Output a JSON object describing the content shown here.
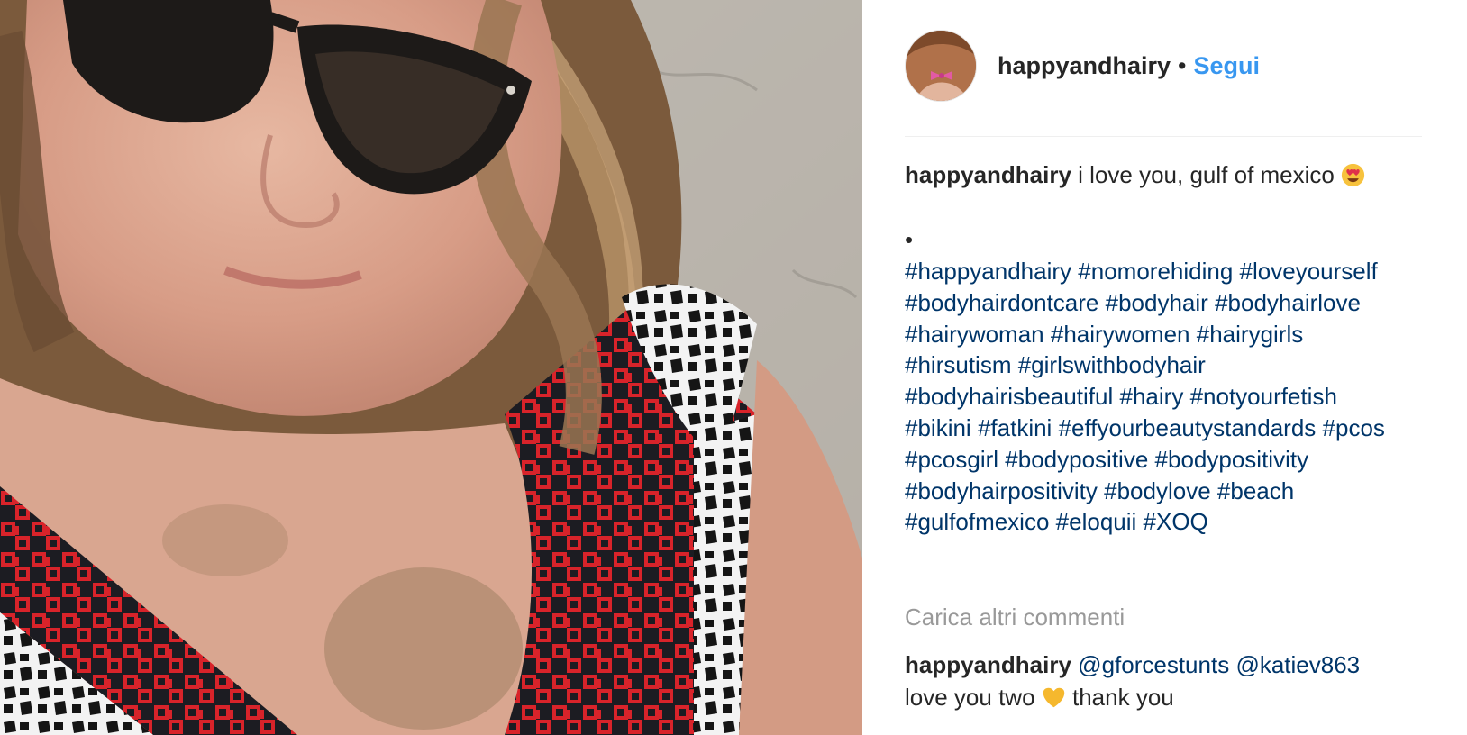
{
  "post": {
    "username": "happyandhairy",
    "separator": "•",
    "follow_label": "Segui"
  },
  "caption": {
    "username": "happyandhairy",
    "text": "i love you, gulf of mexico",
    "emoji": "heart-eyes-emoji",
    "bullet": "•",
    "hashtags": [
      "#happyandhairy",
      "#nomorehiding",
      "#loveyourself",
      "#bodyhairdontcare",
      "#bodyhair",
      "#bodyhairlove",
      "#hairywoman",
      "#hairywomen",
      "#hairygirls",
      "#hirsutism",
      "#girlswithbodyhair",
      "#bodyhairisbeautiful",
      "#hairy",
      "#notyourfetish",
      "#bikini",
      "#fatkini",
      "#effyourbeautystandards",
      "#pcos",
      "#pcosgirl",
      "#bodypositive",
      "#bodypositivity",
      "#bodyhairpositivity",
      "#bodylove",
      "#beach",
      "#gulfofmexico",
      "#eloquii",
      "#XOQ"
    ]
  },
  "load_more_label": "Carica altri commenti",
  "comment": {
    "username": "happyandhairy",
    "mention_1": "@gforcestunts",
    "mention_2": "@katiev863",
    "text_1": "love you two",
    "emoji": "yellow-heart-emoji",
    "text_2": "thank you"
  },
  "colors": {
    "follow": "#3897f0",
    "hashtag": "#003569",
    "text": "#262626",
    "muted": "#999999"
  }
}
